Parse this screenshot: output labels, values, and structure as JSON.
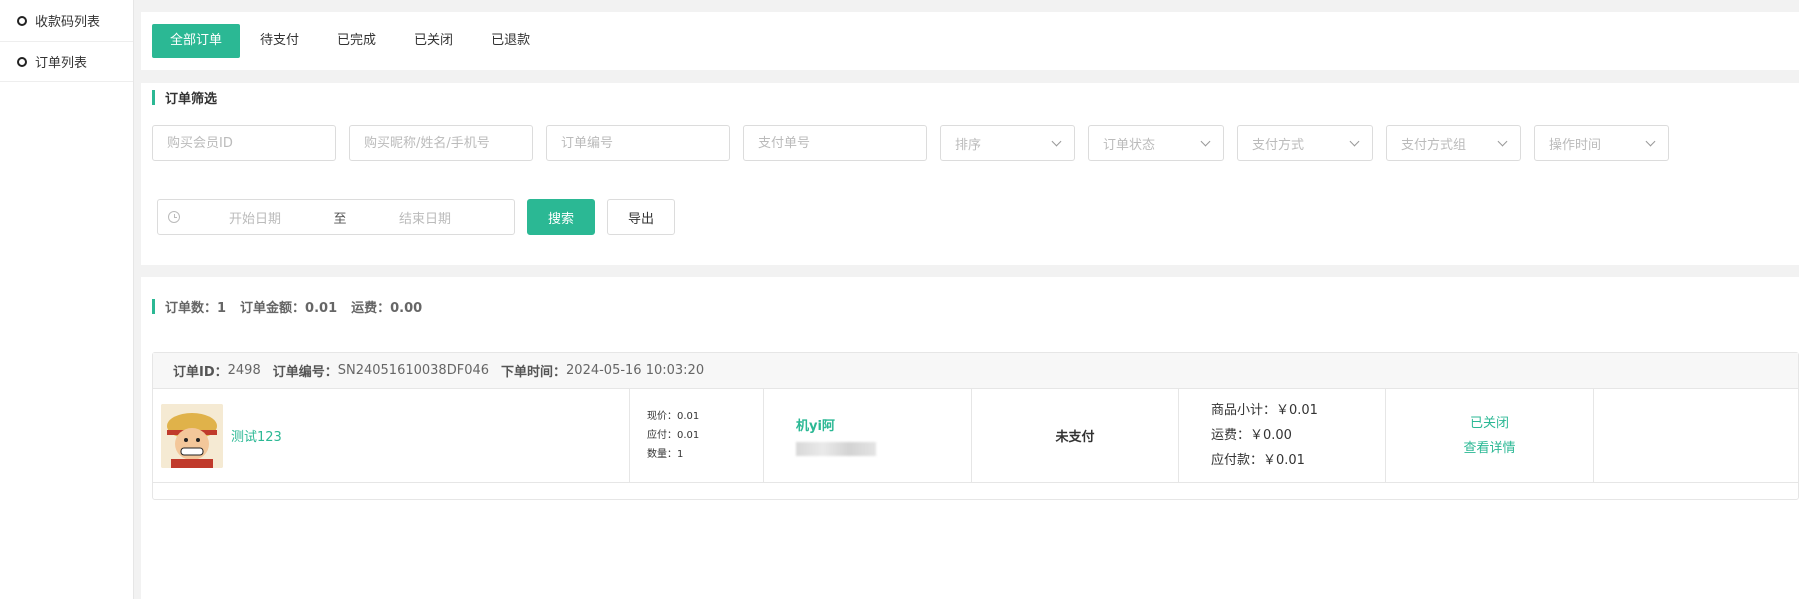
{
  "sidebar": {
    "items": [
      {
        "label": "收款码列表"
      },
      {
        "label": "订单列表"
      }
    ]
  },
  "tabs": [
    {
      "label": "全部订单",
      "active": true
    },
    {
      "label": "待支付"
    },
    {
      "label": "已完成"
    },
    {
      "label": "已关闭"
    },
    {
      "label": "已退款"
    }
  ],
  "filter": {
    "title": "订单筛选",
    "placeholders": {
      "member_id": "购买会员ID",
      "buyer": "购买昵称/姓名/手机号",
      "order_no": "订单编号",
      "pay_no": "支付单号"
    },
    "selects": {
      "sort": "排序",
      "status": "订单状态",
      "pay_method": "支付方式",
      "pay_group": "支付方式组",
      "op_time": "操作时间"
    },
    "date": {
      "start": "开始日期",
      "separator": "至",
      "end": "结束日期"
    },
    "search_label": "搜索",
    "export_label": "导出"
  },
  "summary": {
    "count_label": "订单数：1",
    "amount_label": "订单金额：0.01",
    "shipping_label": "运费：0.00"
  },
  "order": {
    "id_key": "订单ID：",
    "id_val": "2498",
    "no_key": "订单编号：",
    "no_val": "SN24051610038DF046",
    "time_key": "下单时间：",
    "time_val": "2024-05-16 10:03:20",
    "product_name": "测试123",
    "price_now": "现价：0.01",
    "price_due": "应付：0.01",
    "quantity": "数量：1",
    "buyer_name": "机yi阿",
    "status": "未支付",
    "subtotal": "商品小计：￥0.01",
    "shipping": "运费：￥0.00",
    "payable": "应付款：￥0.01",
    "closed_label": "已关闭",
    "detail_label": "查看详情"
  },
  "colors": {
    "accent": "#2bb894"
  }
}
